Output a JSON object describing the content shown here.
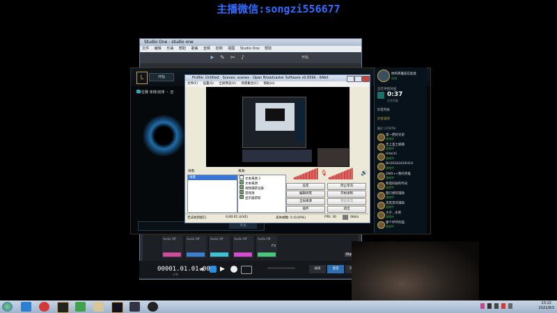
{
  "banner": "主播微信:songzi556677",
  "studio": {
    "title": "Studio One - studio one",
    "menu": [
      "文件",
      "编辑",
      "乐曲",
      "帮助",
      "歌曲",
      "音频",
      "控制",
      "视图",
      "Studio One",
      "帮助"
    ],
    "toolbar_label": "开始",
    "timecode": "00001.01.01.00",
    "timecode_unit": "小节",
    "channel_labels": [
      "Audio Off",
      "Audio Off",
      "Audio Off",
      "Audio Off",
      "Audio Off"
    ],
    "fx_label": "FX",
    "main_label": "Main",
    "right_buttons": [
      "编辑",
      "混音",
      "浏览"
    ]
  },
  "lol": {
    "nav": "排位赛 单排/双排 ・ 召",
    "play_button": "开始",
    "search_placeholder": "",
    "bottom_label": "发送"
  },
  "social": {
    "player_name": "你的英雄名在此处",
    "status": "在线",
    "queue_label": "正在寻找对战",
    "timer": "0:37",
    "mode": "正在匹配",
    "friends_header": "好友列表",
    "group_label": "好友请求",
    "section": "最近 (17/876)",
    "friends": [
      {
        "name": "第一把好兄弟",
        "status": "游戏中"
      },
      {
        "name": "无上圣士楠楠",
        "status": "游戏中"
      },
      {
        "name": "Hitachi",
        "status": "游戏中"
      },
      {
        "name": "BH20183420HCH",
        "status": "游戏中"
      },
      {
        "name": "ZW0++我的英雄",
        "status": "游戏中"
      },
      {
        "name": "和谐同居的时光",
        "status": "游戏中"
      },
      {
        "name": "我只想玩辅助",
        "status": "游戏中"
      },
      {
        "name": "黑黑黑的辅助",
        "status": "游戏中"
      },
      {
        "name": "大于...乐吧",
        "status": "游戏中"
      },
      {
        "name": "那个坏坏的猫",
        "status": "游戏中"
      }
    ]
  },
  "obs": {
    "title": "Profile: Untitled - Scenes: scenes - Open Broadcaster Software v0.659b - 64bit",
    "menu": [
      "文件(F)",
      "设置(S)",
      "全屏预览(V)",
      "场景集合(C)",
      "帮助(H)"
    ],
    "scenes_label": "场景:",
    "sources_label": "来源:",
    "scenes": [
      "场景"
    ],
    "sources": [
      "文本来源 2",
      "文本来源",
      "视频捕获设备",
      "游戏源",
      "显示器获取"
    ],
    "buttons": {
      "settings": "设定",
      "stop_live": "停止串流",
      "edit_scene": "编辑场景",
      "start_record": "开始录制",
      "global_sources": "全局来源",
      "preview_stream": "预览串流",
      "plugins": "插件",
      "exit": "退出"
    },
    "status": {
      "left": "无法找到窗口",
      "time": "0:00:01 (LIVE)",
      "dropped": "丢失帧数: 0 (0.00%)",
      "fps": "FPS: 30",
      "bitrate": "0kb/s"
    }
  },
  "taskbar": {
    "time": "23:22",
    "date": "2021/8/3"
  },
  "colors": {
    "banner": "#2f6cff",
    "obs_bg": "#ece9d8",
    "lol_gold": "#c8a24a",
    "online_green": "#4fb04f",
    "meter_red": "#d0181a"
  }
}
